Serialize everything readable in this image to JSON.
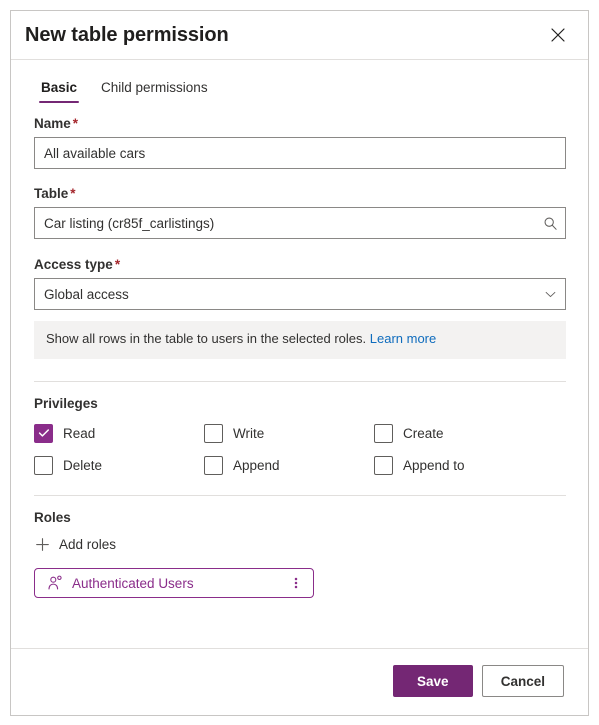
{
  "dialog": {
    "title": "New table permission",
    "close_icon": "close-icon"
  },
  "tabs": [
    {
      "label": "Basic",
      "active": true
    },
    {
      "label": "Child permissions",
      "active": false
    }
  ],
  "fields": {
    "name": {
      "label": "Name",
      "required_marker": "*",
      "value": "All available cars",
      "placeholder": ""
    },
    "table": {
      "label": "Table",
      "required_marker": "*",
      "value": "Car listing (cr85f_carlistings)",
      "placeholder": "",
      "icon": "search-icon"
    },
    "access_type": {
      "label": "Access type",
      "required_marker": "*",
      "value": "Global access",
      "icon": "chevron-down-icon"
    }
  },
  "info_banner": {
    "text": "Show all rows in the table to users in the selected roles.",
    "link_label": "Learn more"
  },
  "privileges": {
    "title": "Privileges",
    "items": [
      {
        "label": "Read",
        "checked": true
      },
      {
        "label": "Write",
        "checked": false
      },
      {
        "label": "Create",
        "checked": false
      },
      {
        "label": "Delete",
        "checked": false
      },
      {
        "label": "Append",
        "checked": false
      },
      {
        "label": "Append to",
        "checked": false
      }
    ]
  },
  "roles": {
    "title": "Roles",
    "add_label": "Add roles",
    "add_icon": "plus-icon",
    "chips": [
      {
        "label": "Authenticated Users",
        "icon": "person-icon",
        "menu_icon": "more-vertical-icon"
      }
    ]
  },
  "footer": {
    "save_label": "Save",
    "cancel_label": "Cancel"
  },
  "colors": {
    "accent_purple": "#742774",
    "chip_purple": "#8a2d8a",
    "link_blue": "#0f6cbd",
    "required_red": "#a4262c",
    "banner_bg": "#f3f2f1",
    "border_gray": "#8a8886",
    "divider_gray": "#e1dfdd"
  }
}
